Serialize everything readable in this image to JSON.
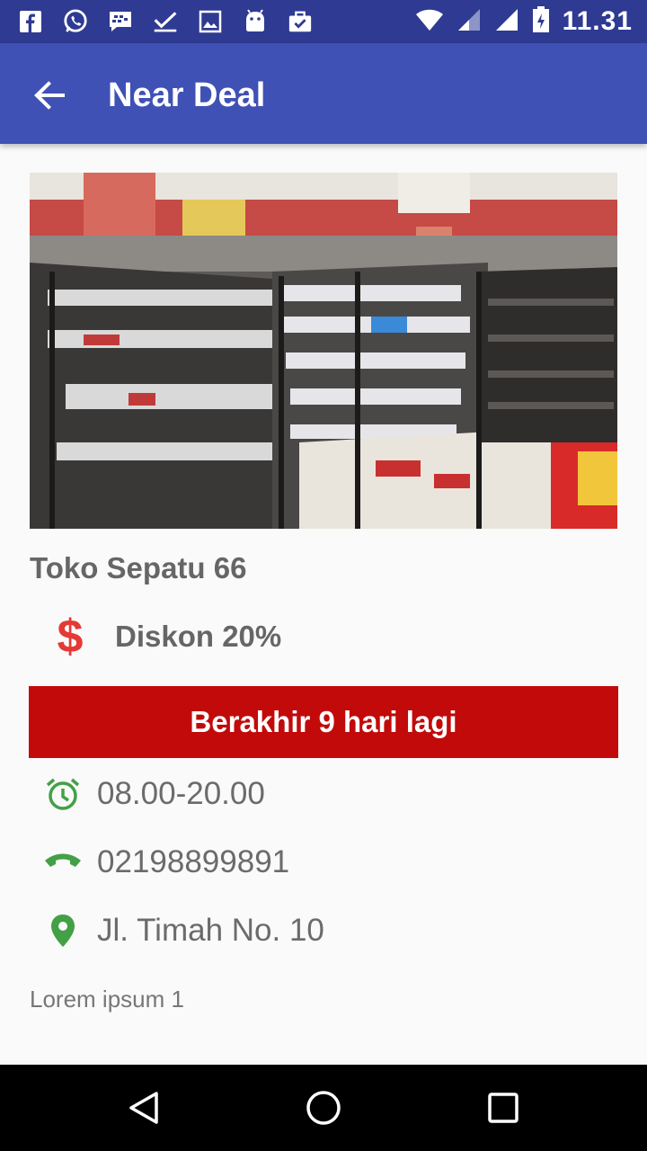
{
  "status_bar": {
    "time": "11.31",
    "icons": [
      "facebook-icon",
      "whatsapp-icon",
      "bbm-icon",
      "check-icon",
      "image-icon",
      "android-icon",
      "briefcase-check-icon"
    ],
    "right_icons": [
      "wifi-icon",
      "signal-icon",
      "signal-icon",
      "battery-icon"
    ]
  },
  "app_bar": {
    "title": "Near Deal"
  },
  "deal": {
    "store_name": "Toko Sepatu 66",
    "discount": "Diskon 20%",
    "deadline": "Berakhir 9 hari lagi",
    "hours": "08.00-20.00",
    "phone": "02198899891",
    "address": "Jl. Timah No. 10",
    "description": "Lorem ipsum 1"
  },
  "colors": {
    "primary": "#3f51b5",
    "primary_dark": "#2f3a92",
    "deadline_bg": "#c20a0a",
    "dollar": "#e53935",
    "info_icon": "#43a047"
  }
}
